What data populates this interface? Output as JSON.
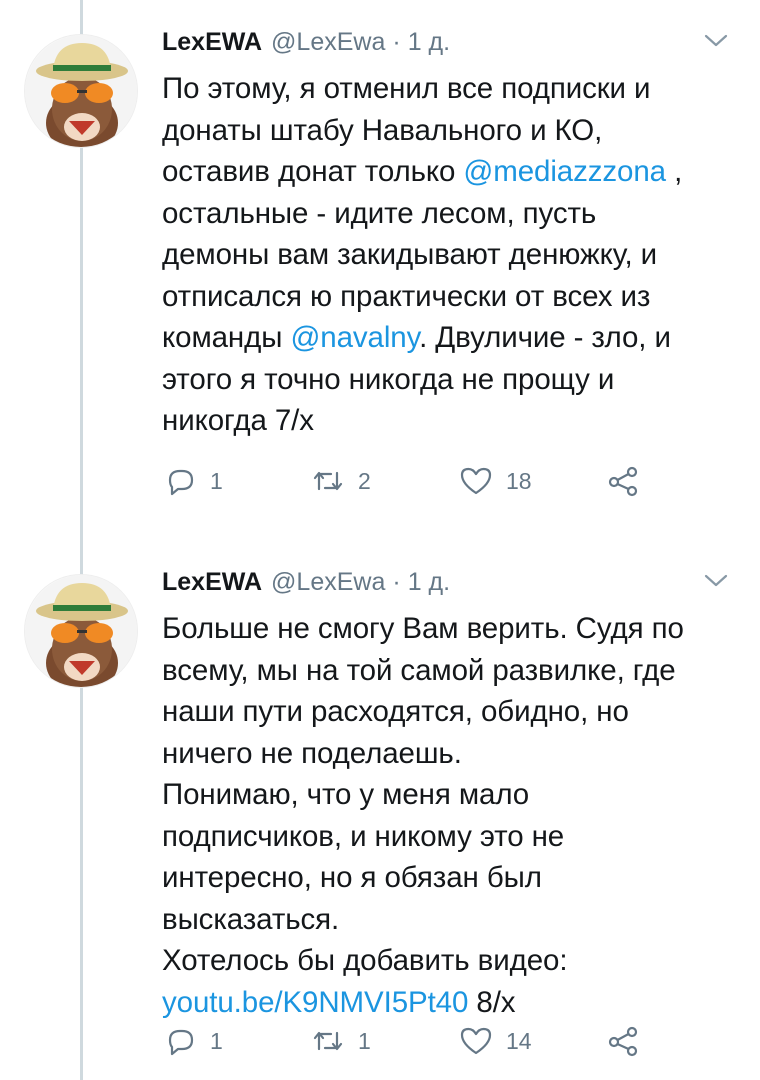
{
  "tweets": [
    {
      "author": {
        "name": "LexEWA",
        "handle": "@LexEwa"
      },
      "separator": "·",
      "time": "1 д.",
      "lines": [
        {
          "text": "По этому, я отменил все подписки и"
        },
        {
          "text": "донаты штабу Навального и КО,"
        },
        {
          "pre": "оставив донат только ",
          "link": "@mediazzzona",
          "post": " ,"
        },
        {
          "text": "остальные - идите лесом, пусть"
        },
        {
          "text": "демоны вам закидывают денюжку, и"
        },
        {
          "text": "отписался ю практически от всех из"
        },
        {
          "pre": "команды ",
          "link": "@navalny",
          "post": ". Двуличие - зло, и"
        },
        {
          "text": "этого я точно никогда не прощу и"
        },
        {
          "text": "никогда 7/х"
        }
      ],
      "stats": {
        "replies": "1",
        "retweets": "2",
        "likes": "18"
      }
    },
    {
      "author": {
        "name": "LexEWA",
        "handle": "@LexEwa"
      },
      "separator": "·",
      "time": "1 д.",
      "lines": [
        {
          "text": "Больше не смогу Вам верить. Судя по"
        },
        {
          "text": "всему, мы на той самой развилке, где"
        },
        {
          "text": "наши пути расходятся, обидно, но"
        },
        {
          "text": "ничего не поделаешь."
        },
        {
          "text": "Понимаю, что у меня мало"
        },
        {
          "text": "подписчиков, и никому это не"
        },
        {
          "text": "интересно, но я обязан был"
        },
        {
          "text": "высказаться."
        },
        {
          "text": "Хотелось бы добавить видео:"
        },
        {
          "pre": "",
          "link": "youtu.be/K9NMVI5Pt40",
          "post": " 8/х"
        }
      ],
      "stats": {
        "replies": "1",
        "retweets": "1",
        "likes": "14"
      }
    }
  ],
  "icons": {
    "reply": "reply-icon",
    "retweet": "retweet-icon",
    "like": "heart-icon",
    "share": "share-icon",
    "caret": "chevron-down-icon"
  },
  "colors": {
    "text": "#14171a",
    "secondary": "#657786",
    "link": "#1b95e0",
    "thread_line": "#cfd9de"
  }
}
